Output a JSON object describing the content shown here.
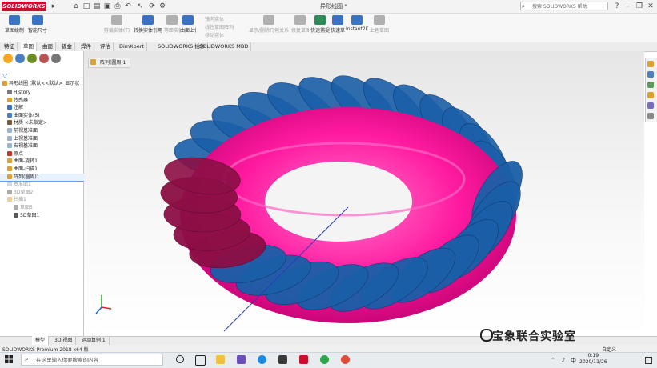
{
  "app": {
    "logo": "SOLIDWORKS",
    "title": "异形线圈 *",
    "search_placeholder": "搜索 SOLIDWORKS 帮助"
  },
  "ribbon": {
    "groups": [
      {
        "label": "草图绘制",
        "icon": "sketch-icon",
        "color": "#3a73c6",
        "dim": false
      },
      {
        "label": "智能尺寸",
        "icon": "smart-dimension-icon",
        "color": "#3a73c6",
        "dim": false
      },
      {
        "label": "剪裁实体(T)",
        "icon": "trim-icon",
        "color": "#b0b0b0",
        "dim": true
      },
      {
        "label": "转换实体引用",
        "icon": "convert-entities-icon",
        "color": "#3a73c6",
        "dim": false
      },
      {
        "label": "等距实体",
        "icon": "offset-icon",
        "color": "#b0b0b0",
        "dim": true
      },
      {
        "label": "曲面上偏移",
        "icon": "surface-offset-icon",
        "color": "#3a73c6",
        "dim": false
      },
      {
        "label": "显示/删除几何关系",
        "icon": "relations-icon",
        "color": "#b0b0b0",
        "dim": true
      },
      {
        "label": "修复草图",
        "icon": "repair-icon",
        "color": "#b0b0b0",
        "dim": true
      },
      {
        "label": "快速捕捉",
        "icon": "quick-snap-icon",
        "color": "#2e8b57",
        "dim": false
      },
      {
        "label": "快速草图",
        "icon": "rapid-sketch-icon",
        "color": "#3a73c6",
        "dim": false
      },
      {
        "label": "Instant2D",
        "icon": "instant2d-icon",
        "color": "#3a73c6",
        "dim": false
      },
      {
        "label": "上色草图轮廓",
        "icon": "shaded-sketch-icon",
        "color": "#b0b0b0",
        "dim": true
      }
    ],
    "small_items": [
      "镜向实体",
      "线性草图阵列",
      "移动实体"
    ]
  },
  "tabs": [
    "特征",
    "草图",
    "曲面",
    "钣金",
    "焊件",
    "评估",
    "DimXpert",
    "SOLIDWORKS 插件",
    "SOLIDWORKS MBD"
  ],
  "active_tab": 1,
  "tree": {
    "root": "异形线圈 (默认<<默认>_显示状",
    "items": [
      {
        "label": "History",
        "icon": "history-icon",
        "dim": false,
        "sel": false,
        "indent": 1
      },
      {
        "label": "传感器",
        "icon": "sensor-icon",
        "dim": false,
        "sel": false,
        "indent": 1
      },
      {
        "label": "注解",
        "icon": "annotation-icon",
        "dim": false,
        "sel": false,
        "indent": 1
      },
      {
        "label": "曲面实体(5)",
        "icon": "surface-bodies-icon",
        "dim": false,
        "sel": false,
        "indent": 1
      },
      {
        "label": "材质 <未指定>",
        "icon": "material-icon",
        "dim": false,
        "sel": false,
        "indent": 1
      },
      {
        "label": "前视基准面",
        "icon": "plane-icon",
        "dim": false,
        "sel": false,
        "indent": 1
      },
      {
        "label": "上视基准面",
        "icon": "plane-icon",
        "dim": false,
        "sel": false,
        "indent": 1
      },
      {
        "label": "右视基准面",
        "icon": "plane-icon",
        "dim": false,
        "sel": false,
        "indent": 1
      },
      {
        "label": "原点",
        "icon": "origin-icon",
        "dim": false,
        "sel": false,
        "indent": 1
      },
      {
        "label": "曲面-旋转1",
        "icon": "revolve-icon",
        "dim": false,
        "sel": false,
        "indent": 1
      },
      {
        "label": "曲面-扫描1",
        "icon": "sweep-icon",
        "dim": false,
        "sel": false,
        "indent": 1
      },
      {
        "label": "阵列(圆周)1",
        "icon": "pattern-icon",
        "dim": false,
        "sel": true,
        "indent": 1
      },
      {
        "label": "基准面1",
        "icon": "plane-icon",
        "dim": true,
        "sel": false,
        "indent": 1
      },
      {
        "label": "3D草图2",
        "icon": "sketch3d-icon",
        "dim": true,
        "sel": false,
        "indent": 1
      },
      {
        "label": "扫描1",
        "icon": "sweep-icon",
        "dim": true,
        "sel": false,
        "indent": 1
      },
      {
        "label": "草图5",
        "icon": "sketch-icon",
        "dim": true,
        "sel": false,
        "indent": 2
      },
      {
        "label": "3D草图1",
        "icon": "sketch3d-icon",
        "dim": false,
        "sel": false,
        "indent": 2
      }
    ]
  },
  "viewport": {
    "tab_label": "阵列(圆周)1",
    "colors": {
      "torus": "#ff1aa0",
      "blades": "#1a5fa8",
      "selected_blades": "#8c0f45"
    }
  },
  "bottom_tabs": [
    "模型",
    "3D 视图",
    "运动算例 1"
  ],
  "status": {
    "left": "SOLIDWORKS Premium 2018 x64 版",
    "right": "自定义"
  },
  "taskbar": {
    "search_placeholder": "在这里输入你要搜索的内容",
    "time": "0:19",
    "date": "2020/11/26",
    "lang": "中"
  },
  "watermark": "宝象联合实验室"
}
